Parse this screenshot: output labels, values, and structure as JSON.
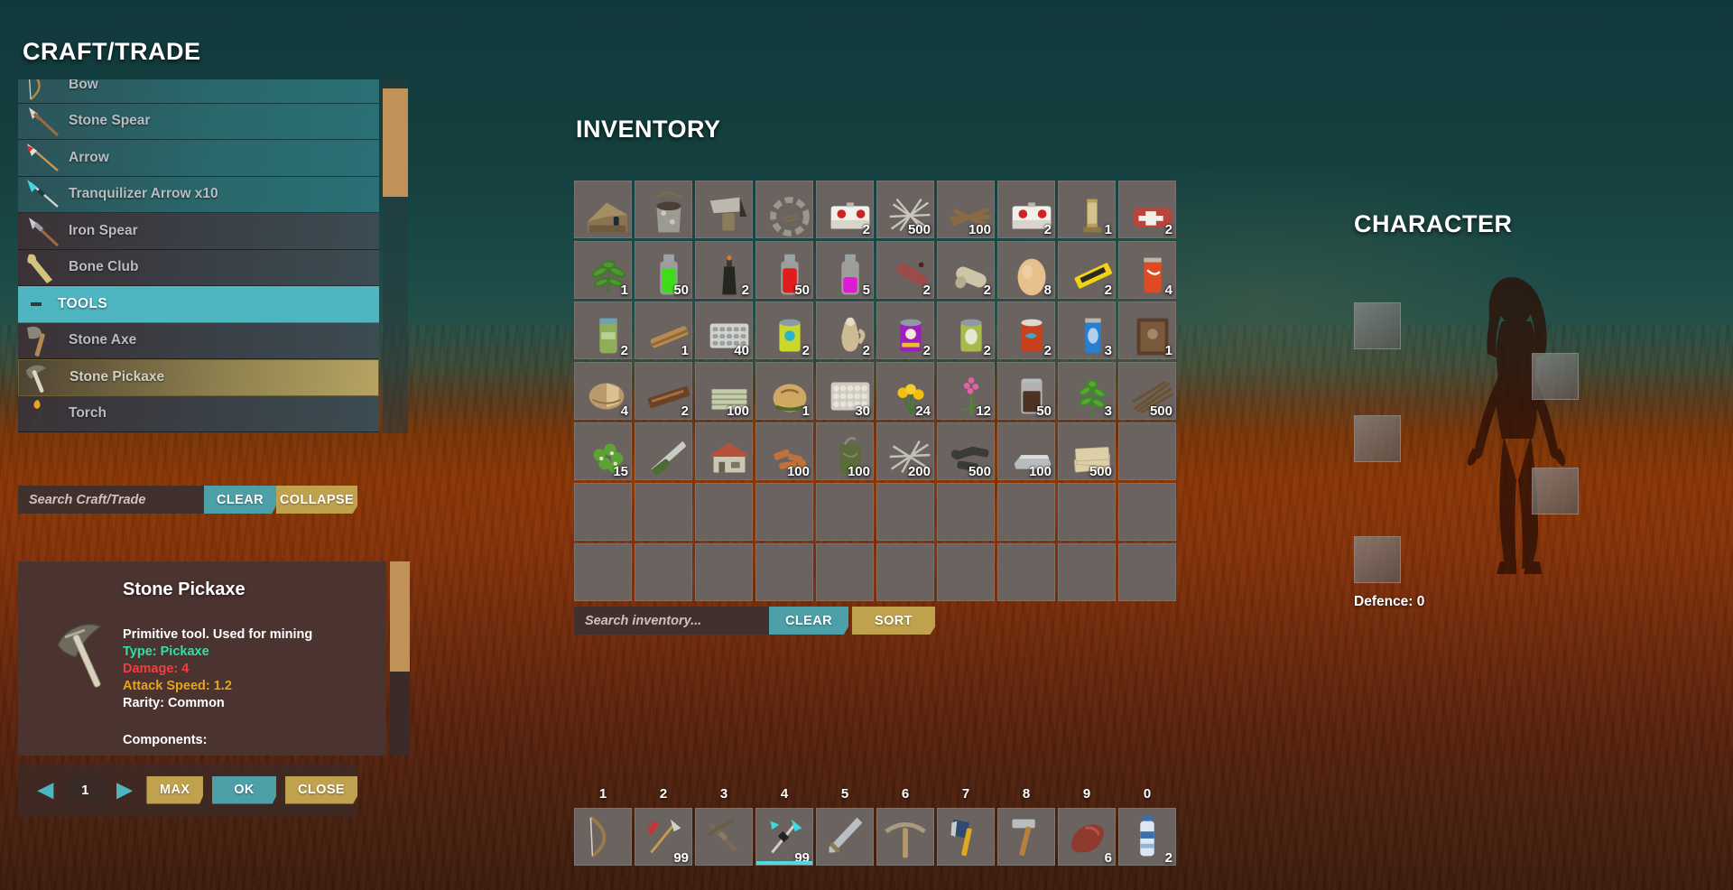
{
  "craft": {
    "title": "CRAFT/TRADE",
    "rows": [
      {
        "label": "Bow",
        "icon": "bow-icon",
        "state": "normal"
      },
      {
        "label": "Stone Spear",
        "icon": "spear-icon",
        "state": "normal"
      },
      {
        "label": "Arrow",
        "icon": "arrow-icon",
        "state": "normal"
      },
      {
        "label": "Tranquilizer Arrow x10",
        "icon": "tranq-arrow-icon",
        "state": "normal"
      },
      {
        "label": "Iron Spear",
        "icon": "iron-spear-icon",
        "state": "dark"
      },
      {
        "label": "Bone Club",
        "icon": "club-icon",
        "state": "dark"
      },
      {
        "label": "TOOLS",
        "icon": "collapse-minus-icon",
        "state": "header"
      },
      {
        "label": "Stone Axe",
        "icon": "axe-icon",
        "state": "dark"
      },
      {
        "label": "Stone Pickaxe",
        "icon": "pickaxe-icon",
        "state": "selected"
      },
      {
        "label": "Torch",
        "icon": "torch-icon",
        "state": "dark"
      }
    ],
    "search_placeholder": "Search Craft/Trade",
    "clear_label": "CLEAR",
    "collapse_label": "COLLAPSE",
    "detail": {
      "name": "Stone Pickaxe",
      "description": "Primitive tool. Used for mining",
      "type": "Type: Pickaxe",
      "damage": "Damage: 4",
      "attack_speed": "Attack Speed: 1.2",
      "rarity": "Rarity: Common",
      "components": "Components:"
    },
    "actions": {
      "prev": "◀",
      "next": "▶",
      "quantity": "1",
      "max_label": "MAX",
      "ok_label": "OK",
      "close_label": "CLOSE"
    }
  },
  "inventory": {
    "title": "INVENTORY",
    "search_placeholder": "Search inventory...",
    "clear_label": "CLEAR",
    "sort_label": "SORT",
    "slots": [
      {
        "name": "wooden-shelter",
        "qty": ""
      },
      {
        "name": "stone-well",
        "qty": ""
      },
      {
        "name": "water-collector",
        "qty": ""
      },
      {
        "name": "stone-campfire",
        "qty": ""
      },
      {
        "name": "medkit-box",
        "qty": "2"
      },
      {
        "name": "nails",
        "qty": "500"
      },
      {
        "name": "firewood",
        "qty": "100"
      },
      {
        "name": "medkit-box-2",
        "qty": "2"
      },
      {
        "name": "gold-trophy",
        "qty": "1"
      },
      {
        "name": "first-aid-kit",
        "qty": "2"
      },
      {
        "name": "green-herb",
        "qty": "1"
      },
      {
        "name": "green-potion",
        "qty": "50"
      },
      {
        "name": "dark-bottle",
        "qty": "2"
      },
      {
        "name": "red-potion",
        "qty": "50"
      },
      {
        "name": "magenta-potion",
        "qty": "5"
      },
      {
        "name": "salami",
        "qty": "2"
      },
      {
        "name": "bandage-roll",
        "qty": "2"
      },
      {
        "name": "egg",
        "qty": "8"
      },
      {
        "name": "candy-bar",
        "qty": "2"
      },
      {
        "name": "soda-can",
        "qty": "4"
      },
      {
        "name": "energy-can",
        "qty": "2"
      },
      {
        "name": "wooden-plank",
        "qty": "1"
      },
      {
        "name": "pill-blister",
        "qty": "40"
      },
      {
        "name": "canned-pet-food",
        "qty": "2"
      },
      {
        "name": "clay-jug",
        "qty": "2"
      },
      {
        "name": "canned-purple",
        "qty": "2"
      },
      {
        "name": "canned-rabbit",
        "qty": "2"
      },
      {
        "name": "canned-fish",
        "qty": "2"
      },
      {
        "name": "blue-can",
        "qty": "3"
      },
      {
        "name": "old-book",
        "qty": "1"
      },
      {
        "name": "tree-stump",
        "qty": "4"
      },
      {
        "name": "wooden-board",
        "qty": "2"
      },
      {
        "name": "plank-stack",
        "qty": "100"
      },
      {
        "name": "bread-loaf",
        "qty": "1"
      },
      {
        "name": "egg-tray",
        "qty": "30"
      },
      {
        "name": "yellow-flowers",
        "qty": "24"
      },
      {
        "name": "pink-flower",
        "qty": "12"
      },
      {
        "name": "soil-jar",
        "qty": "50"
      },
      {
        "name": "green-plant",
        "qty": "3"
      },
      {
        "name": "sticks",
        "qty": "500"
      },
      {
        "name": "berry-bush",
        "qty": "15"
      },
      {
        "name": "folding-knife",
        "qty": ""
      },
      {
        "name": "house-model",
        "qty": ""
      },
      {
        "name": "copper-scrap",
        "qty": "100"
      },
      {
        "name": "green-canister",
        "qty": "100"
      },
      {
        "name": "scrap-metal",
        "qty": "200"
      },
      {
        "name": "bolts",
        "qty": "500"
      },
      {
        "name": "metal-ingot",
        "qty": "100"
      },
      {
        "name": "paper-stack",
        "qty": "500"
      },
      {
        "name": "",
        "qty": ""
      },
      {
        "name": "",
        "qty": ""
      },
      {
        "name": "",
        "qty": ""
      },
      {
        "name": "",
        "qty": ""
      },
      {
        "name": "",
        "qty": ""
      },
      {
        "name": "",
        "qty": ""
      },
      {
        "name": "",
        "qty": ""
      },
      {
        "name": "",
        "qty": ""
      },
      {
        "name": "",
        "qty": ""
      },
      {
        "name": "",
        "qty": ""
      },
      {
        "name": "",
        "qty": ""
      },
      {
        "name": "",
        "qty": ""
      },
      {
        "name": "",
        "qty": ""
      },
      {
        "name": "",
        "qty": ""
      },
      {
        "name": "",
        "qty": ""
      },
      {
        "name": "",
        "qty": ""
      },
      {
        "name": "",
        "qty": ""
      },
      {
        "name": "",
        "qty": ""
      },
      {
        "name": "",
        "qty": ""
      },
      {
        "name": "",
        "qty": ""
      },
      {
        "name": "",
        "qty": ""
      }
    ]
  },
  "character": {
    "title": "CHARACTER",
    "defence": "Defence: 0",
    "equipment_slots": [
      "head",
      "chest",
      "legs",
      "feet",
      "hands",
      "accessory"
    ]
  },
  "hotbar": [
    {
      "key": "1",
      "name": "bow",
      "qty": "",
      "active": false
    },
    {
      "key": "2",
      "name": "arrow",
      "qty": "99",
      "active": false
    },
    {
      "key": "3",
      "name": "crossbow",
      "qty": "",
      "active": false
    },
    {
      "key": "4",
      "name": "tranquilizer-arrow",
      "qty": "99",
      "active": true
    },
    {
      "key": "5",
      "name": "sword",
      "qty": "",
      "active": false
    },
    {
      "key": "6",
      "name": "pickaxe",
      "qty": "",
      "active": false
    },
    {
      "key": "7",
      "name": "axe",
      "qty": "",
      "active": false
    },
    {
      "key": "8",
      "name": "hammer",
      "qty": "",
      "active": false
    },
    {
      "key": "9",
      "name": "meat",
      "qty": "6",
      "active": false
    },
    {
      "key": "0",
      "name": "water-bottle",
      "qty": "2",
      "active": false
    }
  ],
  "colors": {
    "teal_accent": "#4d9fa8",
    "gold_accent": "#c0a24e",
    "header_teal": "#4db6c1",
    "selected_gold": "#b7a463",
    "panel_brown": "#4b332f",
    "slot_gray": "#6a6360"
  }
}
